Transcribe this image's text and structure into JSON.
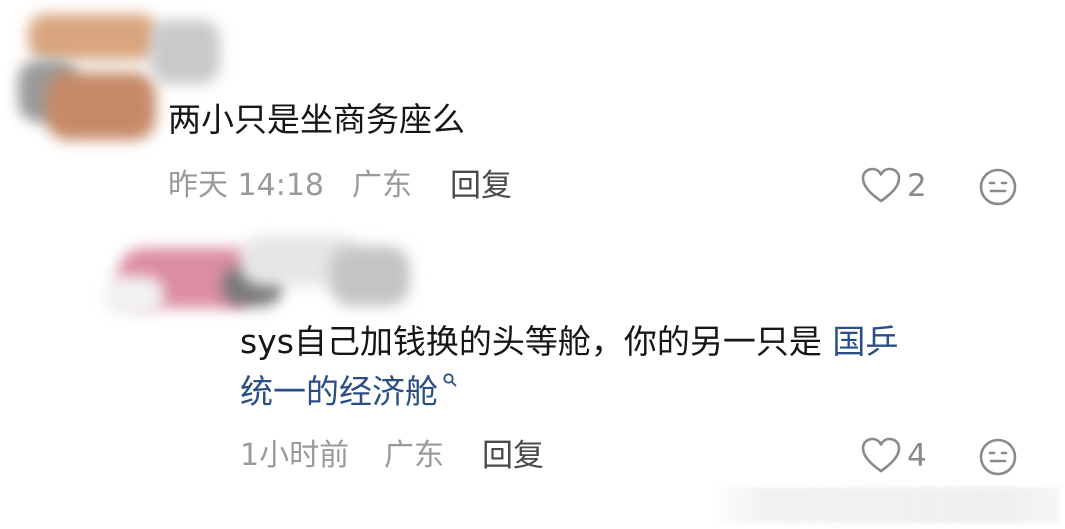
{
  "comments": [
    {
      "content": "两小只是坐商务座么",
      "time": "昨天 14:18",
      "location": "广东",
      "reply_label": "回复",
      "like_icon": "heart-outline-icon",
      "like_count": "2",
      "reaction_icon": "neutral-face-icon"
    },
    {
      "content_line1": "sys自己加钱换的头等舱，你的另一只是 ",
      "topic_part1": "国乒",
      "topic_part2": "统一的经济舱",
      "topic_icon": "search-icon",
      "time": "1小时前",
      "location": "广东",
      "reply_label": "回复",
      "like_icon": "heart-outline-icon",
      "like_count": "4",
      "reaction_icon": "neutral-face-icon"
    }
  ],
  "colors": {
    "text": "#161616",
    "meta": "#9a9a9a",
    "topic": "#2b4f84",
    "icon": "#8a8a8a"
  }
}
